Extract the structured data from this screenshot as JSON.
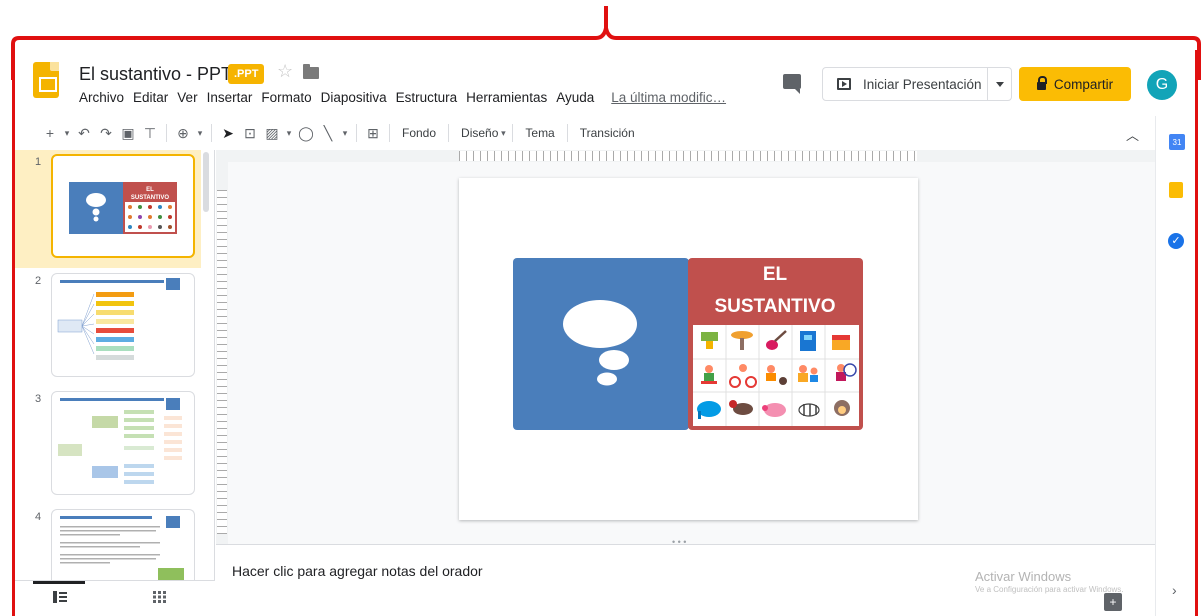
{
  "app": {
    "doc_title": "El sustantivo - PPT",
    "badge": ".PPT",
    "menu": [
      "Archivo",
      "Editar",
      "Ver",
      "Insertar",
      "Formato",
      "Diapositiva",
      "Estructura",
      "Herramientas",
      "Ayuda"
    ],
    "last_edit": "La última modific…",
    "present_label": "Iniciar Presentación",
    "share_label": "Compartir",
    "avatar_letter": "G",
    "colors": {
      "accent": "#fbbc04",
      "avatar": "#12a4b8",
      "annotation": "#e01010"
    }
  },
  "toolbar": {
    "icons": [
      "new-slide-icon",
      "undo-icon",
      "redo-icon",
      "print-icon",
      "paint-format-icon",
      "zoom-icon",
      "select-icon",
      "textbox-icon",
      "image-icon",
      "shape-icon",
      "line-icon",
      "comment-add-icon"
    ],
    "fondo": "Fondo",
    "diseno": "Diseño",
    "tema": "Tema",
    "transicion": "Transición"
  },
  "filmstrip": {
    "slides": [
      {
        "num": "1",
        "selected": true
      },
      {
        "num": "2",
        "selected": false
      },
      {
        "num": "3",
        "selected": false
      },
      {
        "num": "4",
        "selected": false
      }
    ]
  },
  "slide": {
    "title_line1": "EL",
    "title_line2": "SUSTANTIVO",
    "left_color": "#4a7ebb",
    "right_color": "#c0504d",
    "grid_items": [
      "cup-clipart",
      "table-clipart",
      "guitar-clipart",
      "book-clipart",
      "box-clipart",
      "child-clipart",
      "bike-clipart",
      "ball-clipart",
      "kids-clipart",
      "girl-clipart",
      "elephant-clipart",
      "dog-clipart",
      "pig-clipart",
      "zebra-clipart",
      "monkey-clipart"
    ]
  },
  "thumb1": {
    "line1": "EL",
    "line2": "SUSTANTIVO"
  },
  "notes": {
    "placeholder": "Hacer clic para agregar notas del orador",
    "activate_title": "Activar Windows",
    "activate_sub": "Ve a Configuración para activar Windows."
  }
}
